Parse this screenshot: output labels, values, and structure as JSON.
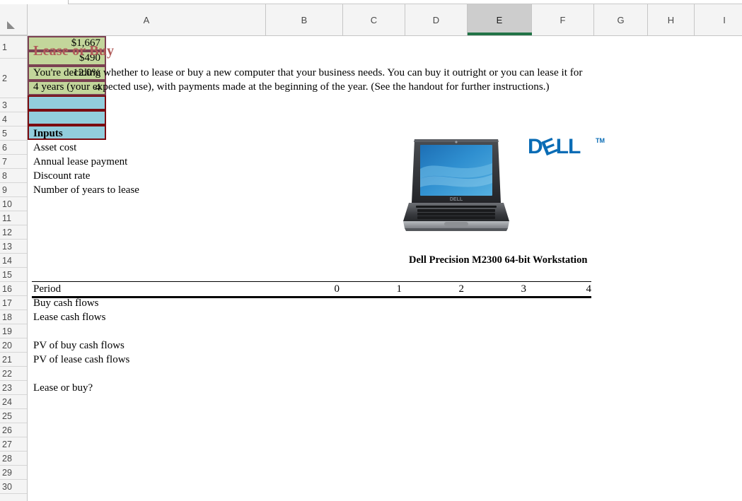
{
  "app": {
    "name": "spreadsheet",
    "select_all_icon": "select-all-triangle-icon"
  },
  "grid": {
    "columns": [
      {
        "label": "A",
        "selected": false
      },
      {
        "label": "B",
        "selected": false
      },
      {
        "label": "C",
        "selected": false
      },
      {
        "label": "D",
        "selected": false
      },
      {
        "label": "E",
        "selected": true
      },
      {
        "label": "F",
        "selected": false
      },
      {
        "label": "G",
        "selected": false
      },
      {
        "label": "H",
        "selected": false
      },
      {
        "label": "I",
        "selected": false
      }
    ],
    "rows": [
      "1",
      "2",
      "3",
      "4",
      "5",
      "6",
      "7",
      "8",
      "9",
      "10",
      "11",
      "12",
      "13",
      "14",
      "15",
      "16",
      "17",
      "18",
      "19",
      "20",
      "21",
      "22",
      "23",
      "24",
      "25",
      "26",
      "27",
      "28",
      "29",
      "30"
    ],
    "selected_column": "E"
  },
  "content": {
    "title": "Lease or Buy",
    "title_color": "#b05a58",
    "description": "You're deciding whether to lease or buy a new computer that your business needs.  You can buy it outright or you can lease it for 4 years (your expected use), with payments made at the beginning of the year.  (See the handout for further instructions.)",
    "inputs_header": "Inputs",
    "input_rows": [
      {
        "label": "Asset cost",
        "value": "$1,667"
      },
      {
        "label": "Annual lease payment",
        "value": "$490"
      },
      {
        "label": "Discount rate",
        "value": "12.0%"
      },
      {
        "label": "Number of years to lease",
        "value": "4"
      }
    ],
    "period_label": "Period",
    "periods": [
      "0",
      "1",
      "2",
      "3",
      "4"
    ],
    "flow_rows": [
      {
        "label": "Buy cash flows"
      },
      {
        "label": "Lease cash flows"
      }
    ],
    "pv_rows": [
      {
        "label": "PV of buy cash flows",
        "value": ""
      },
      {
        "label": "PV of lease cash flows",
        "value": ""
      }
    ],
    "decision_row": {
      "label": "Lease or buy?",
      "value": ""
    },
    "product": {
      "brand": "DELL",
      "brand_tm": "TM",
      "brand_color": "#0a6cb5",
      "caption": "Dell Precision M2300 64-bit Workstation",
      "image_name": "dell-laptop-photo"
    },
    "colors": {
      "input_fill": "#c3d69b",
      "input_border": "#7b4152",
      "output_fill": "#92cddc",
      "output_border": "#7b0b10",
      "selection_accent": "#217346"
    }
  }
}
